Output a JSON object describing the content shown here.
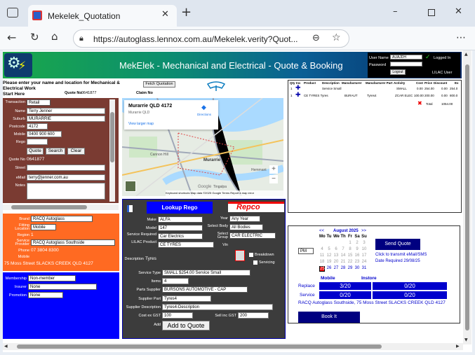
{
  "browser": {
    "tab_title": "Mekelek_Quotation",
    "url": "https://autoglass.lennox.com.au/Mekelek.verity?Quot..."
  },
  "header": {
    "title": "MekElek - Mechanical and Electrical - Quote & Booking",
    "user_label": "User Name",
    "user_value": "AUAJDH",
    "password_label": "Password",
    "login_btn": "Logout",
    "logged_in": "Logged In",
    "user_caption": "LILAC User"
  },
  "intro": {
    "line1": "Please enter your name and location for Mechanical &",
    "line2": "Electrical Work",
    "start": "Start Here",
    "quote_no_label": "Quote No",
    "quote_no": "0641877",
    "fetch_btn": "Fetch Quotation",
    "claim_label": "Claim No"
  },
  "customer": {
    "transaction_label": "Transaction",
    "transaction": "Retail",
    "name_label": "Name",
    "name": "Terry Jenner",
    "suburb_label": "Suburb",
    "suburb": "MURARRIE",
    "postcode_label": "Postcode",
    "postcode": "4172",
    "mobile_label": "Mobile",
    "mobile": "0400 900 600",
    "rego_label": "Rego",
    "quote_btn": "Quote",
    "search_btn": "Search",
    "clear_btn": "Clear",
    "quoteno_label": "Quote No",
    "quoteno": "0641877",
    "street_label": "Street",
    "email_label": "eMail",
    "email": "terry@jenner.com.au",
    "notes_label": "Notes"
  },
  "brand_panel": {
    "brand_label": "Brand",
    "brand": "RACQ Autoglass",
    "fitting_label": "Fitting Location",
    "fitting": "Mobile",
    "region_label": "Region",
    "region": "1",
    "provider_label": "Service Provider",
    "provider": "RACQ Autoglass Southside",
    "phone_label": "Phone",
    "phone": "07 3804 8300",
    "mobile_label": "Mobile",
    "address": "75 Moss Street SLACKS CREEK QLD 4127"
  },
  "member_panel": {
    "membership_label": "Membership",
    "membership": "Non-member",
    "insurer_label": "Insurer",
    "insurer": "None",
    "promotion_label": "Promotion",
    "promotion": "None"
  },
  "map": {
    "place": "Murarrie QLD 4172",
    "sub": "Murarrie QLD",
    "directions": "Directions",
    "larger": "View larger map",
    "footer": "Keyboard shortcuts   Map data ©2025 Google   Terms   Report a map error",
    "label_murarrie": "Murarrie",
    "label_tingalpa": "Tingalpa",
    "label_hemmant": "Hemmant",
    "label_cannon": "Cannon Hill",
    "label_google": "Google"
  },
  "vehicle": {
    "lookup_btn": "Lookup Rego",
    "make_label": "Make",
    "make": "ALFA",
    "year_label": "Year",
    "year": "Any Year",
    "model_label": "Model",
    "model": "147",
    "body_label": "Select Body",
    "body": "All Bodies",
    "service_req_label": "Service Required",
    "service_req": "Car Electrics",
    "group_label": "Select Group",
    "group": "CAR ELECTRIC",
    "lilac_label": "LILAC Product",
    "lilac": "CE TYRES",
    "vin_label": "Vin",
    "desc_label": "Description",
    "desc": "Tyres",
    "breakdown": "Breakdown",
    "servicing": "Servicing",
    "stype_label": "Service Type",
    "stype": "SMALL $254.00 Service Small",
    "items_label": "Items",
    "items": "4",
    "supplier_label": "Parts Supplier",
    "supplier": "BURSONS AUTOMOTIVE - CAP",
    "sup_part_label": "Supplier Part",
    "sup_part": "Tyres4",
    "sup_desc_label": "Supplier Description",
    "sup_desc": "Tyres4-Description",
    "cost_label": "Cost ex GST",
    "cost": "100",
    "sell_label": "Sell inc GST",
    "sell": "200",
    "add_label": "Add",
    "add_btn": "Add to Quote",
    "repco": "Repco"
  },
  "quote_table": {
    "headers": [
      "Qty",
      "Inc",
      "Product",
      "Description",
      "Manufacturer",
      "Manufacturer Part",
      "Activity",
      "Cost",
      "Price",
      "Discount",
      "Ex"
    ],
    "rows": [
      {
        "qty": "1",
        "product": "",
        "description": "Service Small",
        "manufacturer": "",
        "part": "",
        "activity": "SMALL",
        "cost": "0.00",
        "price": "254.00",
        "discount": "0.00",
        "ex": "254.0"
      },
      {
        "qty": "1",
        "product": "CE TYRES Tyres",
        "description": "",
        "manufacturer": "BURAUT",
        "part": "Tyres4",
        "activity": "ZCAR ELEC",
        "cost": "100.00",
        "price": "200.00",
        "discount": "0.00",
        "ex": "800.0"
      }
    ],
    "total_label": "Total",
    "total": "1054.00"
  },
  "booking": {
    "month": "August 2025",
    "dow": [
      "Mo",
      "Tu",
      "We",
      "Th",
      "Fr",
      "Sa",
      "Su"
    ],
    "weeks": [
      [
        "",
        "",
        "",
        "",
        "1",
        "2",
        "3"
      ],
      [
        "4",
        "5",
        "6",
        "7",
        "8",
        "9",
        "10"
      ],
      [
        "11",
        "12",
        "13",
        "14",
        "15",
        "16",
        "17"
      ],
      [
        "18",
        "19",
        "20",
        "21",
        "22",
        "23",
        "24"
      ],
      [
        "25",
        "26",
        "27",
        "28",
        "29",
        "30",
        "31"
      ]
    ],
    "today": "25",
    "ampm": "PM",
    "send_btn": "Send Quote",
    "send_note": "Click to transmit eMail/SMS",
    "date_req": "Date Required 29/08/25",
    "col_mobile": "Mobile",
    "col_instore": "Instore",
    "replace_label": "Replace",
    "replace_mobile": "3/20",
    "replace_instore": "0/20",
    "service_label": "Service",
    "service_mobile": "0/20",
    "service_instore": "0/20",
    "location": "RACQ Autoglass Southside, 75 Moss Street SLACKS CREEK QLD 4127",
    "book_btn": "Book It"
  },
  "colors": {
    "brown": "#7a3b32",
    "orange": "#ff6a22",
    "blue": "#0000ff",
    "dark": "#3c3c3c",
    "navy": "#000080",
    "cal_blue": "#0000cc"
  }
}
